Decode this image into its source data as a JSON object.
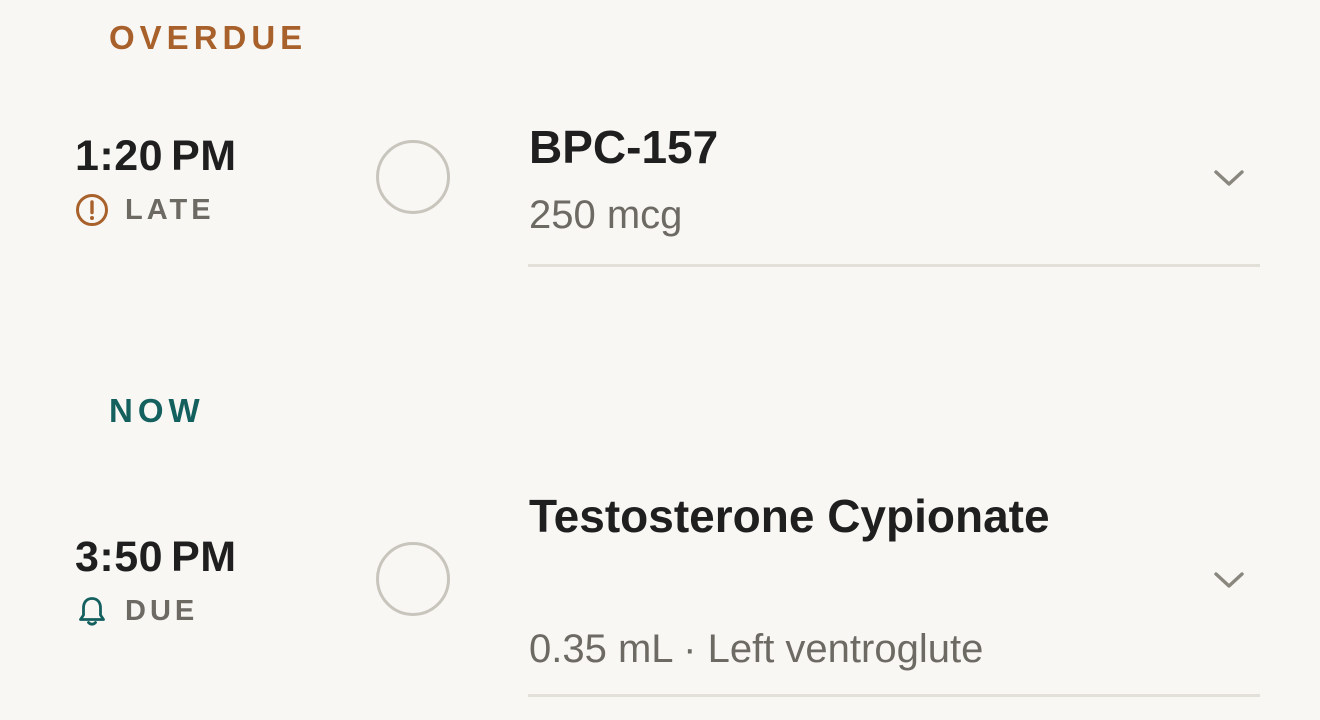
{
  "sections": [
    {
      "label": "OVERDUE",
      "item": {
        "time": "1:20",
        "ampm": "PM",
        "status": "LATE",
        "status_icon": "alert-circle-icon",
        "name": "BPC-157",
        "detail": "250 mcg"
      }
    },
    {
      "label": "NOW",
      "item": {
        "time": "3:50",
        "ampm": "PM",
        "status": "DUE",
        "status_icon": "bell-icon",
        "name": "Testosterone Cypionate",
        "detail": "0.35 mL · Left ventroglute"
      }
    }
  ],
  "colors": {
    "background": "#f8f7f4",
    "overdue_accent": "#a8612a",
    "now_accent": "#14605f",
    "muted_text": "#6d6a64",
    "checkbox_border": "#c8c5bd",
    "divider": "#e3e0d9"
  }
}
